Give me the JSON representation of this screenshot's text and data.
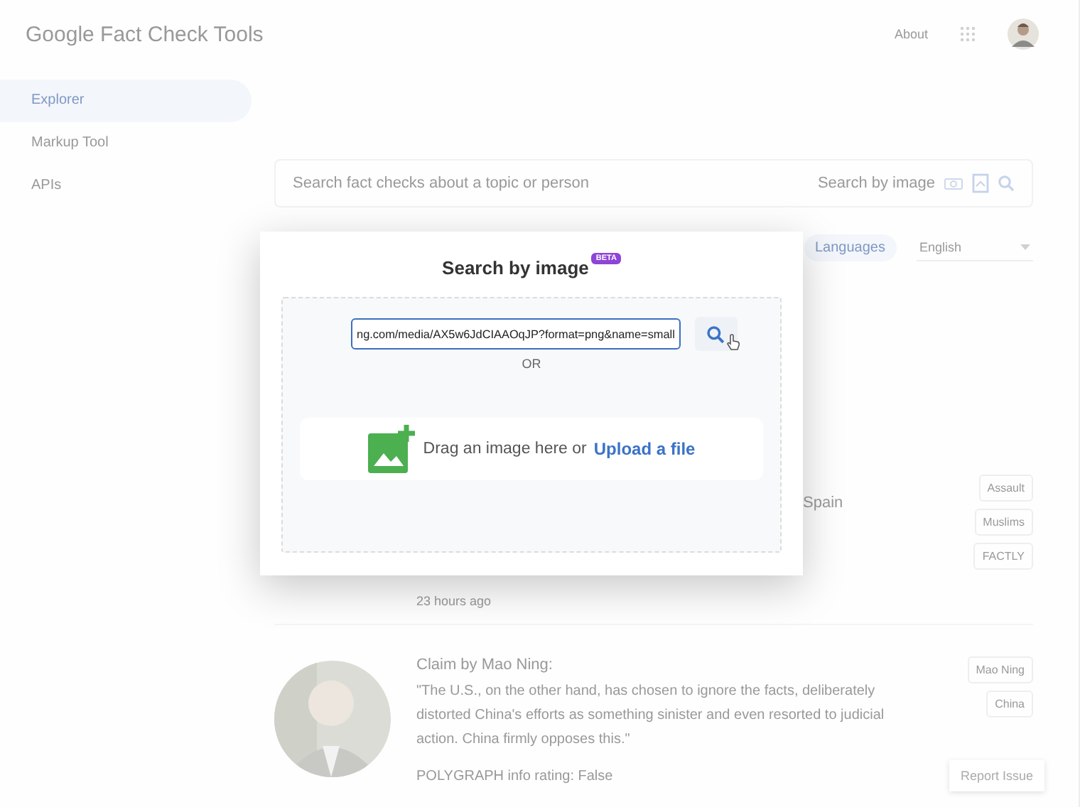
{
  "header": {
    "logo": "Google Fact Check Tools",
    "about": "About"
  },
  "sidebar": {
    "items": [
      {
        "label": "Explorer",
        "selected": true
      },
      {
        "label": "Markup Tool",
        "selected": false
      },
      {
        "label": "APIs",
        "selected": false
      }
    ]
  },
  "search": {
    "placeholder": "Search fact checks about a topic or person",
    "image_search": "Search by image"
  },
  "filters": {
    "languages_label": "Languages",
    "language": "English"
  },
  "results": [
    {
      "title": "Spain",
      "tags": [
        "Assault",
        "Muslims",
        "FACTLY"
      ],
      "time": "23 hours ago"
    },
    {
      "title": "Claim by Mao Ning:",
      "quote": "\"The U.S., on the other hand, has chosen to ignore the facts, deliberately distorted China's efforts as something sinister and even resorted to judicial action. China firmly opposes this.\"",
      "rating": "POLYGRAPH info rating: False",
      "tags": [
        "Mao Ning",
        "China"
      ]
    }
  ],
  "report_issue": "Report Issue",
  "dialog": {
    "title": "Search by image",
    "badge": "BETA",
    "url_value": "ng.com/media/AX5w6JdCIAAOqJP?format=png&name=small",
    "or": "OR",
    "drop_text": "Drag an image here or",
    "upload_link": "Upload a file"
  }
}
